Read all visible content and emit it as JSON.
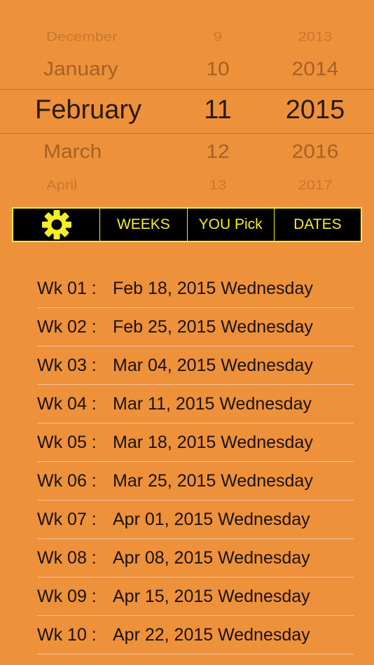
{
  "picker": {
    "months": [
      "December",
      "January",
      "February",
      "March",
      "April"
    ],
    "days": [
      "9",
      "10",
      "11",
      "12",
      "13"
    ],
    "years": [
      "2013",
      "2014",
      "2015",
      "2016",
      "2017"
    ]
  },
  "toolbar": {
    "settings_icon": "gear-icon",
    "weeks_label": "WEEKS",
    "you_pick_label": "YOU Pick",
    "dates_label": "DATES"
  },
  "colors": {
    "background": "#EE913B",
    "toolbar_background": "#000000",
    "toolbar_accent": "#F4EE2B"
  },
  "weeks": [
    {
      "label": "Wk 01 :",
      "date": "Feb 18, 2015 Wednesday"
    },
    {
      "label": "Wk 02 :",
      "date": "Feb 25, 2015 Wednesday"
    },
    {
      "label": "Wk 03 :",
      "date": "Mar 04, 2015 Wednesday"
    },
    {
      "label": "Wk 04 :",
      "date": "Mar 11, 2015 Wednesday"
    },
    {
      "label": "Wk 05 :",
      "date": "Mar 18, 2015 Wednesday"
    },
    {
      "label": "Wk 06 :",
      "date": "Mar 25, 2015 Wednesday"
    },
    {
      "label": "Wk 07 :",
      "date": "Apr 01, 2015 Wednesday"
    },
    {
      "label": "Wk 08 :",
      "date": "Apr 08, 2015 Wednesday"
    },
    {
      "label": "Wk 09 :",
      "date": "Apr 15, 2015 Wednesday"
    },
    {
      "label": "Wk 10 :",
      "date": "Apr 22, 2015 Wednesday"
    }
  ]
}
